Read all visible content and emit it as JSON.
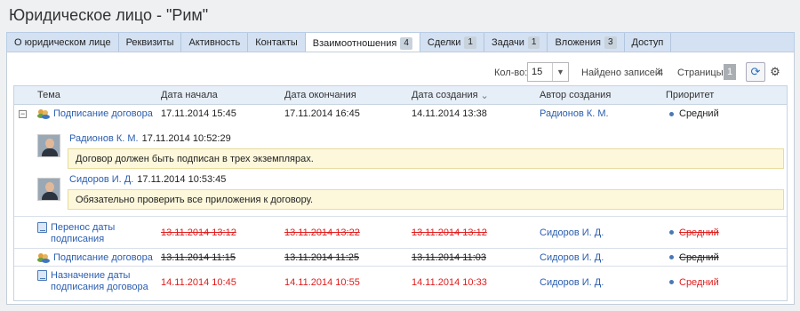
{
  "title": "Юридическое лицо - \"Рим\"",
  "tabs": [
    {
      "label": "О юридическом лице",
      "badge": ""
    },
    {
      "label": "Реквизиты",
      "badge": ""
    },
    {
      "label": "Активность",
      "badge": ""
    },
    {
      "label": "Контакты",
      "badge": ""
    },
    {
      "label": "Взаимоотношения",
      "badge": "4"
    },
    {
      "label": "Сделки",
      "badge": "1"
    },
    {
      "label": "Задачи",
      "badge": "1"
    },
    {
      "label": "Вложения",
      "badge": "3"
    },
    {
      "label": "Доступ",
      "badge": ""
    }
  ],
  "toolbar": {
    "count_label": "Кол-во:",
    "count_value": "15",
    "found_label": "Найдено записей:",
    "found_value": "4",
    "pages_label": "Страницы:",
    "page_value": "1",
    "refresh_icon": "refresh-icon",
    "settings_icon": "gear-icon"
  },
  "columns": [
    "Тема",
    "Дата начала",
    "Дата окончания",
    "Дата создания",
    "Автор создания",
    "Приоритет"
  ],
  "sort_indicator": "⌄",
  "expander_symbol": "−",
  "rows": [
    {
      "subject": "Подписание договора",
      "start": "17.11.2014 15:45",
      "end": "17.11.2014 16:45",
      "created": "14.11.2014 13:38",
      "author": "Радионов К. М.",
      "priority": "Средний"
    },
    {
      "subject": "Перенос даты подписания",
      "start": "13.11.2014 13:12",
      "end": "13.11.2014 13:22",
      "created": "13.11.2014 13:12",
      "author": "Сидоров И. Д.",
      "priority": "Средний"
    },
    {
      "subject": "Подписание договора",
      "start": "13.11.2014 11:15",
      "end": "13.11.2014 11:25",
      "created": "13.11.2014 11:03",
      "author": "Сидоров И. Д.",
      "priority": "Средний"
    },
    {
      "subject": "Назначение даты подписания договора",
      "start": "14.11.2014 10:45",
      "end": "14.11.2014 10:55",
      "created": "14.11.2014 10:33",
      "author": "Сидоров И. Д.",
      "priority": "Средний"
    }
  ],
  "comments": [
    {
      "author": "Радионов К. М.",
      "time": "17.11.2014 10:52:29",
      "text": "Договор должен быть подписан в трех экземплярах."
    },
    {
      "author": "Сидоров И. Д.",
      "time": "17.11.2014 10:53:45",
      "text": "Обязательно проверить все приложения к договору."
    }
  ],
  "colors": {
    "link": "#2a5db0",
    "overdue": "#e01b1b",
    "priority_dot": "#4a78b5"
  }
}
